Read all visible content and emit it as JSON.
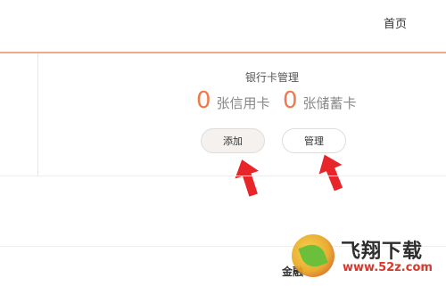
{
  "header": {
    "home_label": "首页"
  },
  "bank_card": {
    "title": "银行卡管理",
    "credit_count": "0",
    "credit_label": "张信用卡",
    "debit_count": "0",
    "debit_label": "张储蓄卡",
    "add_label": "添加",
    "manage_label": "管理"
  },
  "watermark": {
    "brand": "飞翔下载",
    "url": "www.52z.com"
  },
  "footer_partial": {
    "text": "金融"
  },
  "colors": {
    "accent": "#f07a4c",
    "arrow": "#e8262a",
    "divider": "#f3a78b"
  }
}
